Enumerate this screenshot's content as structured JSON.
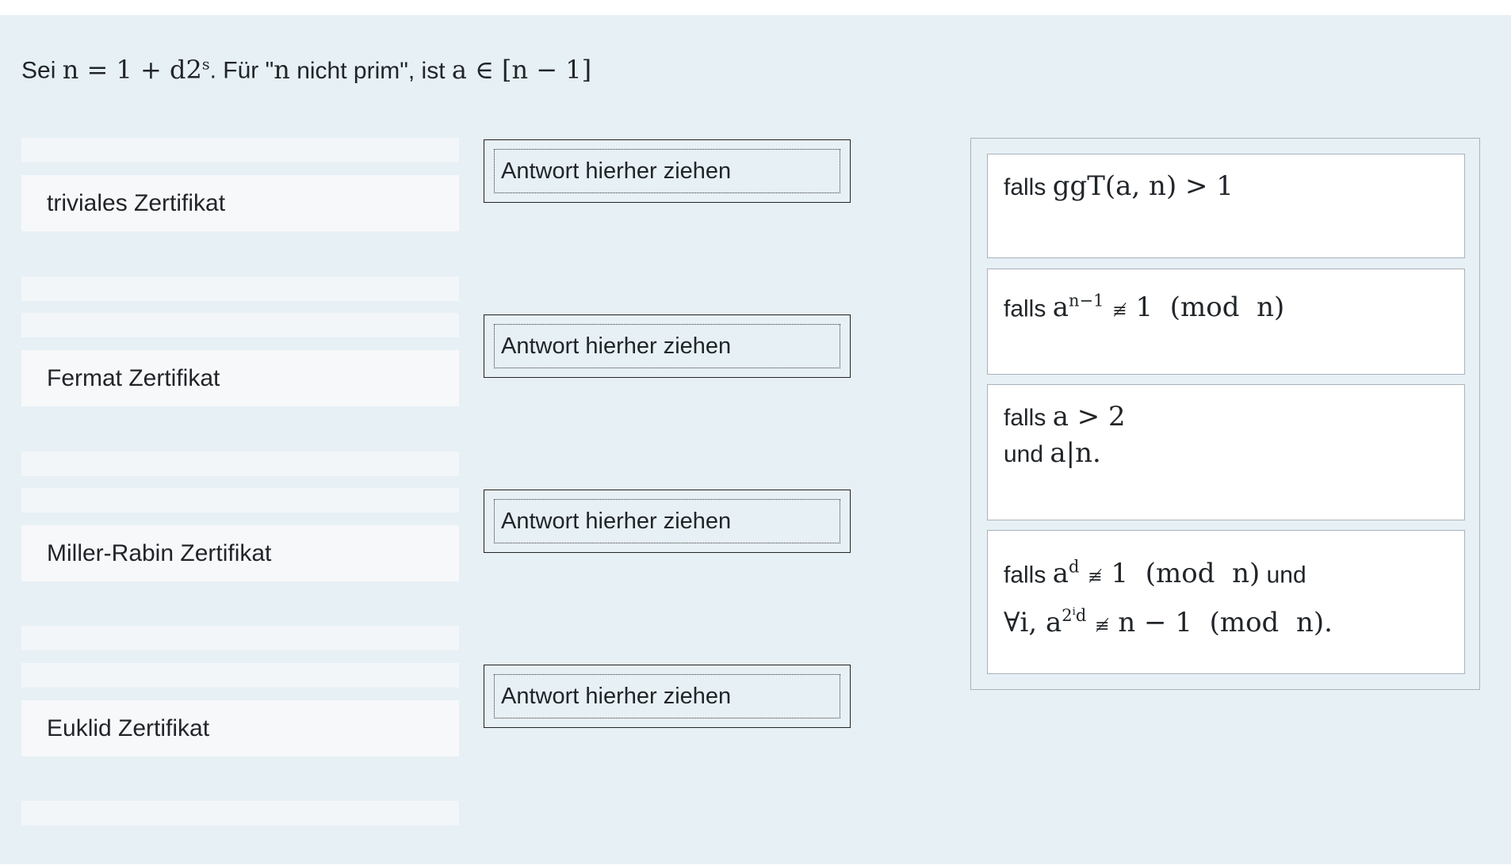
{
  "question": {
    "prefix": "Sei ",
    "formula_html": "<span class=\"m\">n = 1 + d2<sup>s</sup></span>",
    "middle": ". Für \"",
    "condition_html": "<span class=\"m\">n</span> nicht prim\", ist ",
    "tail_html": "<span class=\"m\">a ∈ [n − 1]</span>"
  },
  "terms": [
    {
      "label": "triviales Zertifikat"
    },
    {
      "label": "Fermat Zertifikat"
    },
    {
      "label": "Miller-Rabin Zertifikat"
    },
    {
      "label": "Euklid Zertifikat"
    }
  ],
  "dropzones": [
    {
      "label": "Antwort hierher ziehen"
    },
    {
      "label": "Antwort hierher ziehen"
    },
    {
      "label": "Antwort hierher ziehen"
    },
    {
      "label": "Antwort hierher ziehen"
    }
  ],
  "answers": [
    {
      "html": "falls <span class=\"m\">ggT(a, n) &gt; 1</span>"
    },
    {
      "html": "falls <span class=\"m\">a<sup>n−1</sup> <span class=\"neq\">≢</span> 1&nbsp;&nbsp;(mod&nbsp;&nbsp;n)</span>"
    },
    {
      "html": "falls <span class=\"m\">a &gt; 2</span><br>und <span class=\"m\">a|n.</span>"
    },
    {
      "html": "falls <span class=\"m\">a<sup>d</sup> <span class=\"neq\">≢</span> 1&nbsp;&nbsp;(mod&nbsp;&nbsp;n)</span> und<br><span class=\"m\">∀i, a<sup>2<sup style=\"font-size:13px\">i</sup>d</sup> <span class=\"neq\">≢</span> n − 1&nbsp;&nbsp;(mod&nbsp;&nbsp;n).</span>"
    }
  ]
}
